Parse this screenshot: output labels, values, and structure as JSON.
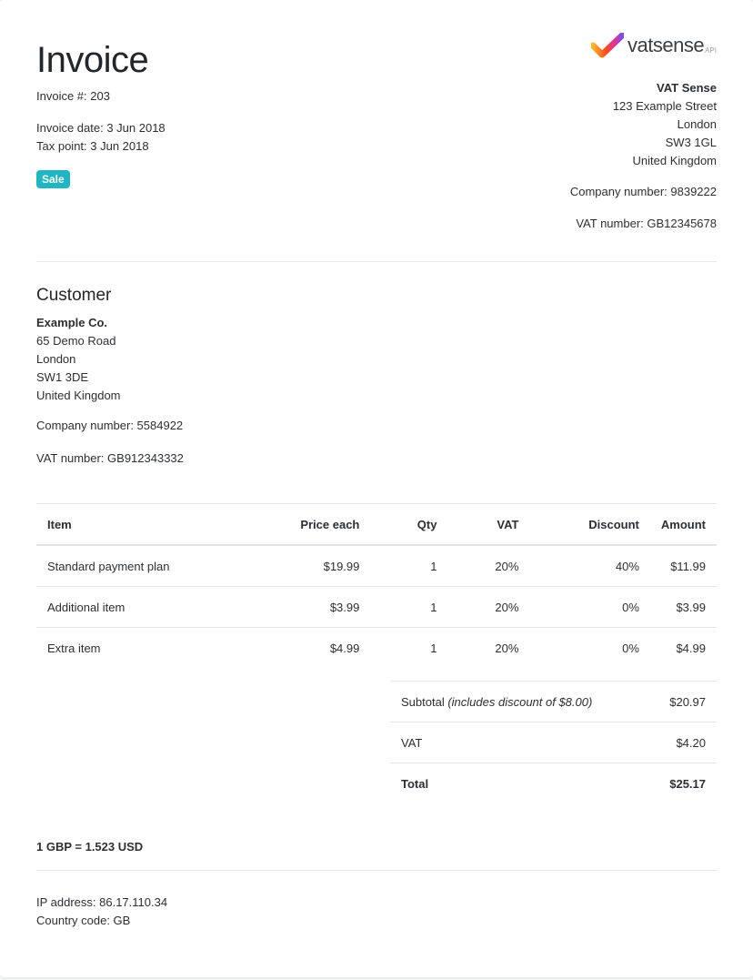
{
  "invoice": {
    "title": "Invoice",
    "number": "Invoice #: 203",
    "date": "Invoice date: 3 Jun 2018",
    "tax_point": "Tax point: 3 Jun 2018",
    "badge": "Sale"
  },
  "logo": {
    "text": "vatsense",
    "suffix": "API",
    "colors": [
      "#f7b733",
      "#fc4a1a",
      "#e0339f",
      "#7b4fe3"
    ]
  },
  "seller": {
    "name": "VAT Sense",
    "address": [
      "123 Example Street",
      "London",
      "SW3 1GL",
      "United Kingdom"
    ],
    "company_number": "Company number: 9839222",
    "vat_number": "VAT number: GB12345678"
  },
  "customer": {
    "heading": "Customer",
    "name": "Example Co.",
    "address": [
      "65 Demo Road",
      "London",
      "SW1 3DE",
      "United Kingdom"
    ],
    "company_number": "Company number: 5584922",
    "vat_number": "VAT number: GB912343332"
  },
  "table": {
    "headers": [
      "Item",
      "Price each",
      "Qty",
      "VAT",
      "Discount",
      "Amount"
    ],
    "rows": [
      [
        "Standard payment plan",
        "$19.99",
        "1",
        "20%",
        "40%",
        "$11.99"
      ],
      [
        "Additional item",
        "$3.99",
        "1",
        "20%",
        "0%",
        "$3.99"
      ],
      [
        "Extra item",
        "$4.99",
        "1",
        "20%",
        "0%",
        "$4.99"
      ]
    ]
  },
  "totals": {
    "subtotal_label": "Subtotal",
    "subtotal_note": "(includes discount of $8.00)",
    "subtotal_value": "$20.97",
    "vat_label": "VAT",
    "vat_value": "$4.20",
    "total_label": "Total",
    "total_value": "$25.17"
  },
  "exchange_rate": "1 GBP = 1.523 USD",
  "footer": {
    "ip": "IP address: 86.17.110.34",
    "country": "Country code: GB"
  },
  "colors": {
    "badge": "#1fb5c2",
    "text": "#2b2f33",
    "divider": "#e6e8ea"
  }
}
